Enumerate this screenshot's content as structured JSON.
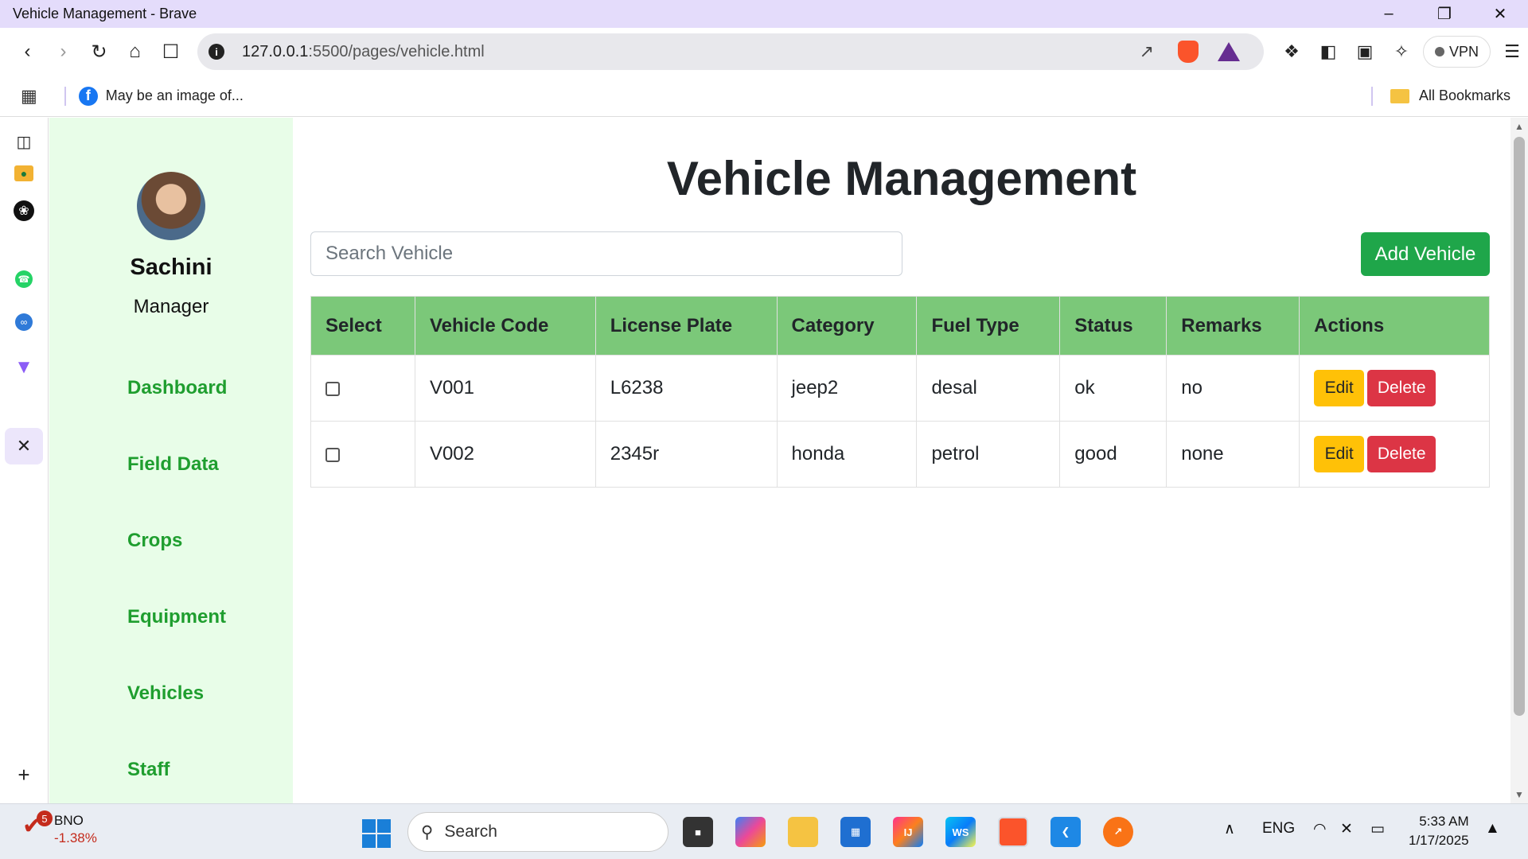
{
  "window": {
    "title": "Vehicle Management - Brave"
  },
  "browser": {
    "url_host": "127.0.0.1",
    "url_path": ":5500/pages/vehicle.html",
    "vpn_label": "VPN",
    "bookmark_item": "May be an image of...",
    "all_bookmarks": "All Bookmarks"
  },
  "sidebar": {
    "user_name": "Sachini",
    "user_role": "Manager",
    "nav": [
      "Dashboard",
      "Field Data",
      "Crops",
      "Equipment",
      "Vehicles",
      "Staff"
    ]
  },
  "main": {
    "heading": "Vehicle Management",
    "search_placeholder": "Search Vehicle",
    "add_button": "Add Vehicle",
    "columns": [
      "Select",
      "Vehicle Code",
      "License Plate",
      "Category",
      "Fuel Type",
      "Status",
      "Remarks",
      "Actions"
    ],
    "rows": [
      {
        "code": "V001",
        "plate": "L6238",
        "category": "jeep2",
        "fuel": "desal",
        "status": "ok",
        "remarks": "no"
      },
      {
        "code": "V002",
        "plate": "2345r",
        "category": "honda",
        "fuel": "petrol",
        "status": "good",
        "remarks": "none"
      }
    ],
    "edit_label": "Edit",
    "delete_label": "Delete"
  },
  "taskbar": {
    "stock_badge": "5",
    "stock_name": "BNO",
    "stock_change": "-1.38%",
    "search_label": "Search",
    "lang": "ENG",
    "time": "5:33 AM",
    "date": "1/17/2025"
  },
  "colors": {
    "app_sidebar_bg": "#e8fde8",
    "nav_text": "#1f9e2f",
    "table_header": "#7bc879",
    "add_button": "#1fa64a",
    "edit_button": "#ffc107",
    "delete_button": "#dc3545"
  }
}
